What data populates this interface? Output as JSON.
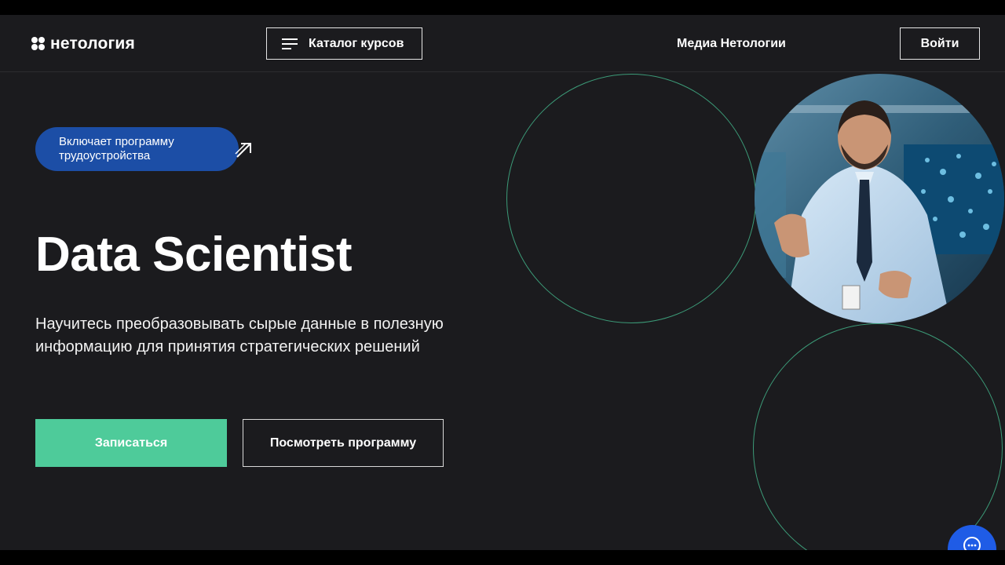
{
  "header": {
    "logo_text": "нетология",
    "catalog_label": "Каталог курсов",
    "media_link": "Медиа Нетологии",
    "login_label": "Войти"
  },
  "hero": {
    "badge_text": "Включает программу трудоустройства",
    "title": "Data Scientist",
    "subtitle": "Научитесь преобразовывать сырые данные в полезную информацию для принятия стратегических решений",
    "primary_button": "Записаться",
    "secondary_button": "Посмотреть программу"
  },
  "colors": {
    "background": "#1b1b1e",
    "accent_green": "#4ecb9a",
    "ring_green": "#3c9b78",
    "badge_blue": "#1c4ea6",
    "chat_blue": "#1f5ce6"
  },
  "icons": {
    "logo": "four-dots-logo-icon",
    "catalog": "menu-icon",
    "badge": "arrow-up-right-icon",
    "chat": "chat-icon"
  }
}
